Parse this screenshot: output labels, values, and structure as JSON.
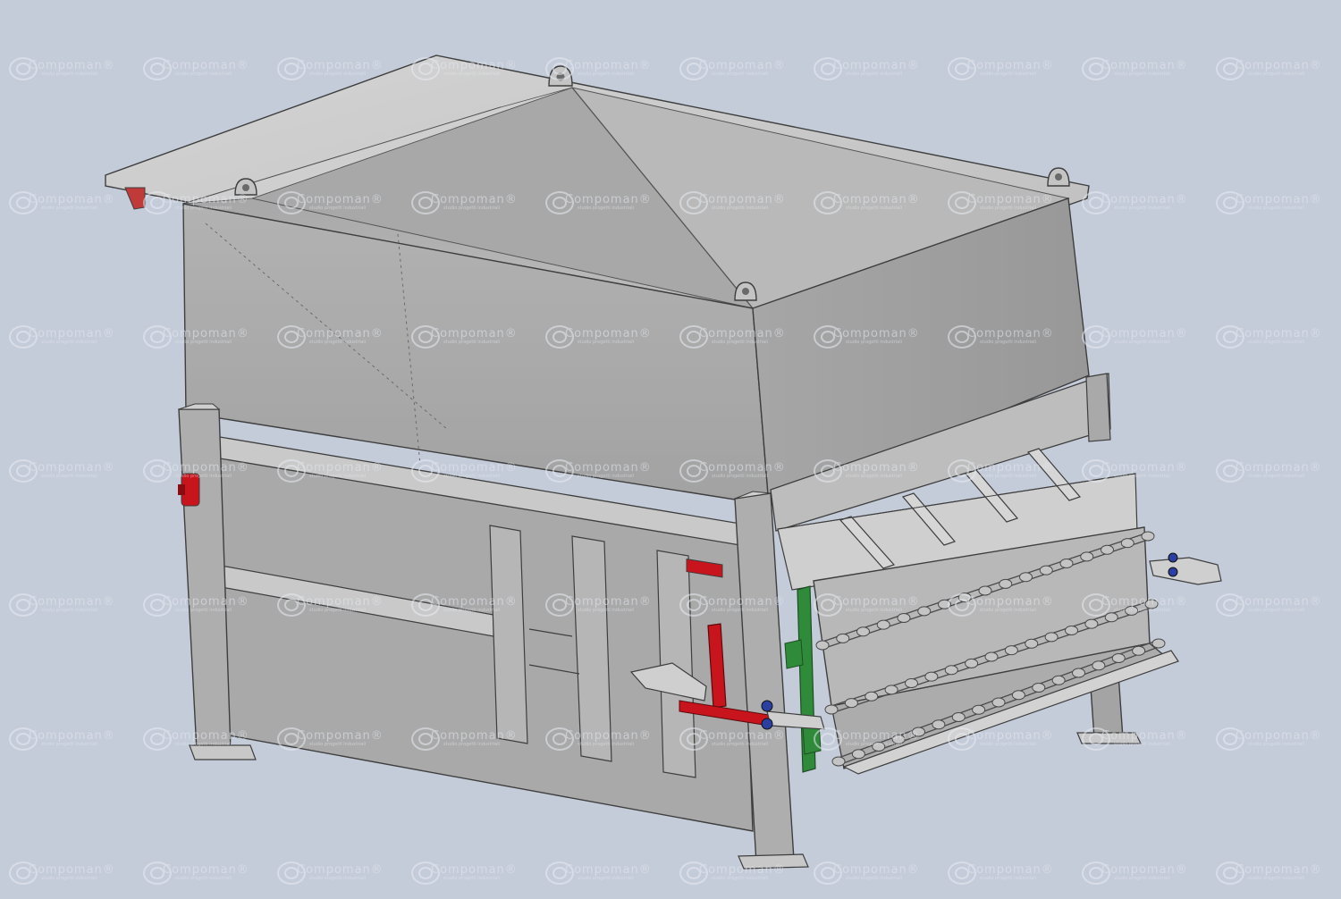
{
  "watermark": {
    "brand": "Compoman",
    "tagline": "studio progetti industriali",
    "mark": "®"
  },
  "colors": {
    "background": "#c5ccd9",
    "steel_light": "#c9c9c9",
    "steel_mid": "#a9a9a9",
    "steel_dark": "#8e8e8e",
    "edge": "#3e3e3e",
    "lock_red": "#c8141c",
    "guide_green": "#2f8a3a",
    "bolt_blue": "#2a3fa0"
  },
  "parts": [
    {
      "name": "hopper",
      "color": "steel_light"
    },
    {
      "name": "compaction-chamber",
      "color": "steel_mid"
    },
    {
      "name": "frame-legs",
      "color": "steel_mid"
    },
    {
      "name": "roller-door",
      "color": "steel_light"
    },
    {
      "name": "door-lock-handle",
      "color": "lock_red"
    },
    {
      "name": "door-guide",
      "color": "guide_green"
    },
    {
      "name": "lifting-eyes",
      "color": "steel_light"
    }
  ]
}
